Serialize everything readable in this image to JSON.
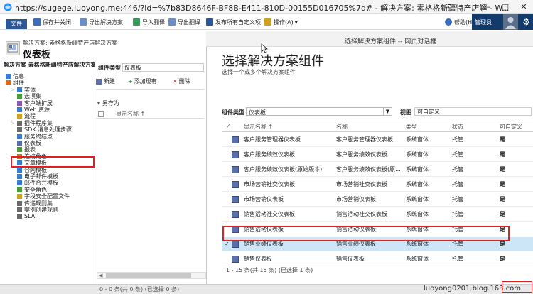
{
  "browser": {
    "url": "https://sugege.luoyong.me:446/?id=%7b83D8646F-BF8B-E411-810D-00155D016705%7d# - 解决方案: 素格格新疆特产店解 - W...",
    "minimize": "—",
    "restore": "□",
    "close": "✕"
  },
  "ribbon": {
    "file": "文件",
    "save_close": "保存并关闭",
    "export_solution": "导出解决方案",
    "import_translation": "导入翻译",
    "export_translation": "导出翻译",
    "publish_all": "发布所有自定义项",
    "actions": "操作(A)",
    "actions_arrow": "▾",
    "help": "帮助(H)",
    "help_arrow": "▾"
  },
  "user": {
    "name": "管理员"
  },
  "solution": {
    "crumb": "解决方案: 素格格新疆特产店解决方案",
    "entity_title": "仪表板",
    "explorer_label": "解决方案 素格格新疆特产店解决方案"
  },
  "sidebar": {
    "items": [
      {
        "label": "信息",
        "indent": 0,
        "color": "#3a7bd5",
        "arrow": ""
      },
      {
        "label": "组件",
        "indent": 0,
        "color": "#d96b1c",
        "arrow": ""
      },
      {
        "label": "实体",
        "indent": 1,
        "color": "#3a7bd5",
        "arrow": "▷"
      },
      {
        "label": "选项集",
        "indent": 1,
        "color": "#4a9a3a",
        "arrow": ""
      },
      {
        "label": "客户端扩展",
        "indent": 1,
        "color": "#8a5ab0",
        "arrow": ""
      },
      {
        "label": "Web 资源",
        "indent": 1,
        "color": "#3a7bd5",
        "arrow": ""
      },
      {
        "label": "流程",
        "indent": 1,
        "color": "#d0a020",
        "arrow": ""
      },
      {
        "label": "插件程序集",
        "indent": 1,
        "color": "#6a6a6a",
        "arrow": "▷"
      },
      {
        "label": "SDK 消息处理步骤",
        "indent": 1,
        "color": "#6a6a6a",
        "arrow": ""
      },
      {
        "label": "服务终结点",
        "indent": 1,
        "color": "#3a7bd5",
        "arrow": ""
      },
      {
        "label": "仪表板",
        "indent": 1,
        "color": "#5b6fa8",
        "arrow": ""
      },
      {
        "label": "报表",
        "indent": 1,
        "color": "#4a9a3a",
        "arrow": ""
      },
      {
        "label": "连接角色",
        "indent": 1,
        "color": "#d96b1c",
        "arrow": ""
      },
      {
        "label": "文章模板",
        "indent": 1,
        "color": "#3a7bd5",
        "arrow": ""
      },
      {
        "label": "合同模板",
        "indent": 1,
        "color": "#3a7bd5",
        "arrow": ""
      },
      {
        "label": "电子邮件模板",
        "indent": 1,
        "color": "#3a7bd5",
        "arrow": ""
      },
      {
        "label": "邮件合并模板",
        "indent": 1,
        "color": "#3a7bd5",
        "arrow": ""
      },
      {
        "label": "安全角色",
        "indent": 1,
        "color": "#4a9a3a",
        "arrow": ""
      },
      {
        "label": "字段安全配置文件",
        "indent": 1,
        "color": "#d0a020",
        "arrow": ""
      },
      {
        "label": "传递规则集",
        "indent": 1,
        "color": "#6a6a6a",
        "arrow": ""
      },
      {
        "label": "案例创建规则",
        "indent": 1,
        "color": "#6a6a6a",
        "arrow": ""
      },
      {
        "label": "SLA",
        "indent": 1,
        "color": "#6a6a6a",
        "arrow": ""
      }
    ]
  },
  "middle": {
    "type_label": "组件类型",
    "type_value": "仪表板",
    "new": "新建",
    "add_existing": "添加现有",
    "delete": "删除",
    "save_as": "另存为",
    "col_display_name": "显示名称 ↑",
    "status": "0 - 0 条(共 0 条) (已选择 0 条)"
  },
  "dialog": {
    "title": "选择解决方案组件 -- 网页对话框",
    "heading": "选择解决方案组件",
    "subheading": "选择一个或多个解决方案组件",
    "component_type_label": "组件类型",
    "component_type_value": "仪表板",
    "view_label": "视图",
    "view_value": "可自定义",
    "columns": [
      "显示名称 ↑",
      "名称",
      "类型",
      "状态",
      "可自定义"
    ],
    "rows": [
      {
        "display": "客户服务管理器仪表板",
        "name": "客户服务管理器仪表板",
        "type": "系统窗体",
        "state": "托管",
        "custom": "是",
        "selected": false
      },
      {
        "display": "客户服务绩效仪表板",
        "name": "客户服务绩效仪表板",
        "type": "系统窗体",
        "state": "托管",
        "custom": "是",
        "selected": false
      },
      {
        "display": "客户服务绩效仪表板(原始版本)",
        "name": "客户服务绩效仪表板(原...",
        "type": "系统窗体",
        "state": "托管",
        "custom": "是",
        "selected": false
      },
      {
        "display": "市场营销社交仪表板",
        "name": "市场营销社交仪表板",
        "type": "系统窗体",
        "state": "托管",
        "custom": "是",
        "selected": false
      },
      {
        "display": "市场营销仪表板",
        "name": "市场营销仪表板",
        "type": "系统窗体",
        "state": "托管",
        "custom": "是",
        "selected": false
      },
      {
        "display": "销售活动社交仪表板",
        "name": "销售活动社交仪表板",
        "type": "系统窗体",
        "state": "托管",
        "custom": "是",
        "selected": false
      },
      {
        "display": "销售活动仪表板",
        "name": "销售活动仪表板",
        "type": "系统窗体",
        "state": "托管",
        "custom": "是",
        "selected": false
      },
      {
        "display": "销售业绩仪表板",
        "name": "销售业绩仪表板",
        "type": "系统窗体",
        "state": "托管",
        "custom": "是",
        "selected": true
      },
      {
        "display": "销售仪表板",
        "name": "销售仪表板",
        "type": "系统窗体",
        "state": "托管",
        "custom": "是",
        "selected": false
      }
    ],
    "checkmark": "✓",
    "footer": "1 - 15 条(共 15 条) (已选择 1 条)"
  },
  "statusbar": {
    "watermark": "luoyong0201.blog.163.com"
  },
  "colors": {
    "accent": "#2b5797",
    "highlight_red": "#e02020",
    "selected_row": "#cde6f7",
    "user_block": "#123a6a"
  }
}
